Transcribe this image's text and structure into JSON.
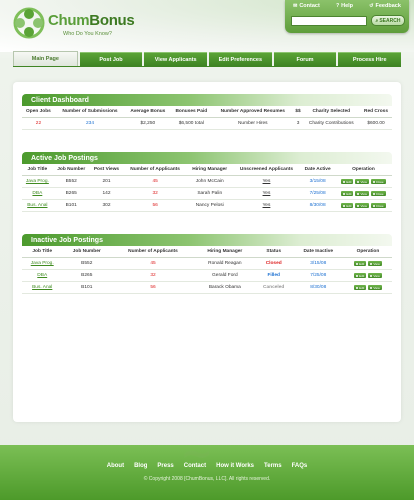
{
  "brand": {
    "name_light": "Chum",
    "name_bold": "Bonus",
    "tagline": "Who Do You Know?"
  },
  "top": {
    "contact": "Contact",
    "help": "Help",
    "feedback": "Feedback",
    "search_placeholder": "",
    "search_button": "SEARCH"
  },
  "nav": [
    "Main Page",
    "Post Job",
    "View Applicants",
    "Edit Preferences",
    "Forum",
    "Process Hire"
  ],
  "dashboard": {
    "title": "Client Dashboard",
    "headers": [
      "Open Jobs",
      "Number of Submissions",
      "Average Bonus",
      "Bonuses Paid",
      "Number Approved Resumes",
      "$$",
      "Charity Selected",
      "Red Cross"
    ],
    "row": [
      "22",
      "234",
      "$2,250",
      "$6,500 total",
      "Number Hires",
      "3",
      "Charity Contributions",
      "$600.00"
    ]
  },
  "active": {
    "title": "Active Job Postings",
    "headers": [
      "Job Title",
      "Job Number",
      "Post Views",
      "Number of Applicants",
      "Hiring Manager",
      "Unscreened Applicants",
      "Date Active",
      "Operation"
    ],
    "rows": [
      [
        "Java Prog.",
        "B552",
        "201",
        "45",
        "John McCain",
        "Yes",
        "3/15/08"
      ],
      [
        "DBA",
        "B265",
        "142",
        "32",
        "Sarah Palin",
        "Yes",
        "7/25/08"
      ],
      [
        "Bus. Anal",
        "B101",
        "302",
        "56",
        "Nancy Pelosi",
        "Yes",
        "8/30/08"
      ]
    ],
    "ops": [
      "Edit",
      "View",
      "Close"
    ]
  },
  "inactive": {
    "title": "Inactive Job Postings",
    "headers": [
      "Job Title",
      "Job Number",
      "Number of Applicants",
      "Hiring Manager",
      "Status",
      "Date Inactive",
      "Operation"
    ],
    "rows": [
      [
        "Java Prog.",
        "B552",
        "45",
        "Ronald Reagan",
        "Closed",
        "3/15/08"
      ],
      [
        "DBA",
        "B265",
        "32",
        "Gerald Ford",
        "Filled",
        "7/25/08"
      ],
      [
        "Bus. Anal",
        "B101",
        "56",
        "Barack Obama",
        "Canceled",
        "8/30/08"
      ]
    ],
    "ops": [
      "Edit",
      "View"
    ]
  },
  "footer": {
    "links": [
      "About",
      "Blog",
      "Press",
      "Contact",
      "How it Works",
      "Terms",
      "FAQs"
    ],
    "copyright": "© Copyright 2008 [ChumBonus, LLC]. All rights reserved."
  }
}
